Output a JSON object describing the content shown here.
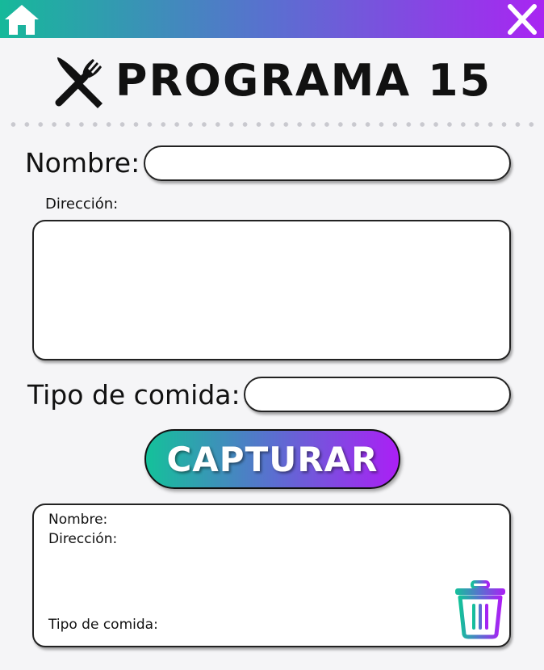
{
  "header": {
    "home_icon": "home-icon",
    "close_icon": "close-icon",
    "gradient_start": "#16b99a",
    "gradient_end": "#a925f2"
  },
  "title": {
    "icon": "fork-knife-icon",
    "text": "PROGRAMA 15"
  },
  "form": {
    "nombre_label": "Nombre:",
    "nombre_value": "",
    "direccion_label": "Dirección:",
    "direccion_value": "",
    "tipo_label": "Tipo de comida:",
    "tipo_value": ""
  },
  "capture_button": {
    "label": "CAPTURAR"
  },
  "result": {
    "nombre_label": "Nombre:",
    "direccion_label": "Dirección:",
    "tipo_label": "Tipo de comida:",
    "delete_icon": "trash-icon"
  }
}
